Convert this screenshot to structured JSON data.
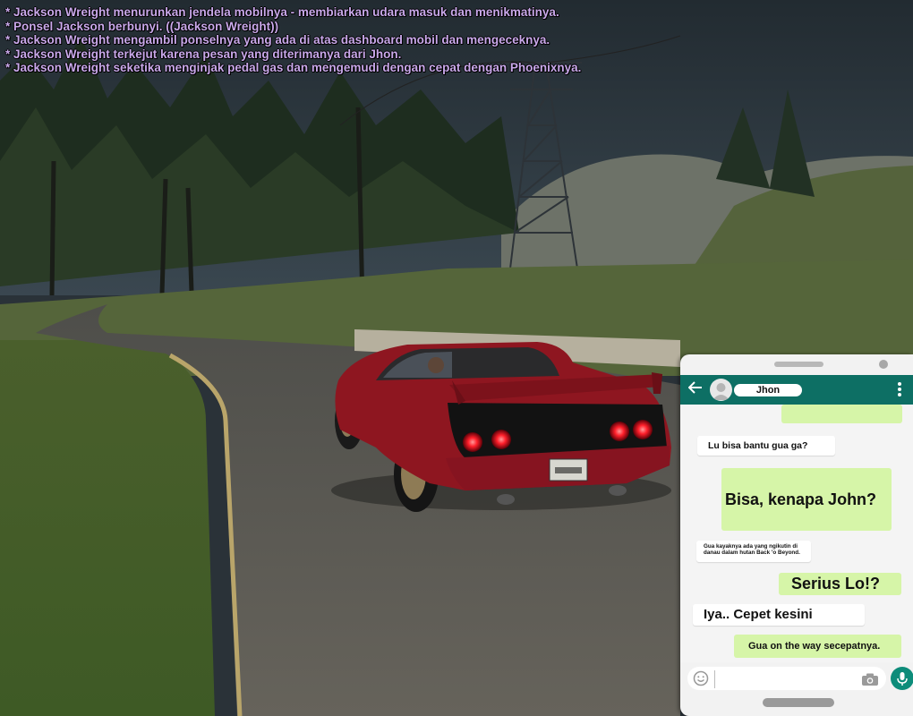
{
  "chat_log": [
    "* Jackson Wreight menurunkan jendela mobilnya - membiarkan udara masuk dan menikmatinya.",
    "* Ponsel Jackson berbunyi. ((Jackson Wreight))",
    "* Jackson Wreight mengambil ponselnya yang ada di atas dashboard mobil dan mengeceknya.",
    "* Jackson Wreight terkejut karena pesan yang diterimanya dari Jhon.",
    "* Jackson Wreight seketika menginjak pedal gas dan mengemudi dengan cepat dengan Phoenixnya."
  ],
  "phone": {
    "contact_name": "Jhon",
    "messages": [
      {
        "from": "me",
        "text": ""
      },
      {
        "from": "them",
        "text": "Lu bisa bantu gua ga?"
      },
      {
        "from": "me",
        "text": "Bisa, kenapa John?"
      },
      {
        "from": "them",
        "text": "Gua kayaknya ada yang ngikutin di danau dalam hutan Back 'o Beyond."
      },
      {
        "from": "me",
        "text": "Serius Lo!?"
      },
      {
        "from": "them",
        "text": "Iya.. Cepet kesini"
      },
      {
        "from": "me",
        "text": "Gua on the way secepatnya."
      }
    ],
    "input_placeholder": "",
    "icons": {
      "back": "arrow-left-icon",
      "avatar": "user-avatar-icon",
      "menu": "kebab-menu-icon",
      "emoji": "emoji-icon",
      "camera": "camera-icon",
      "mic": "microphone-icon"
    }
  },
  "colors": {
    "chat_text": "#c9a8ea",
    "app_bar": "#0d6f64",
    "sent_bubble": "#d6f5a8",
    "received_bubble": "#ffffff",
    "mic_button": "#0d8c7a",
    "car_body": "#8e1620"
  }
}
